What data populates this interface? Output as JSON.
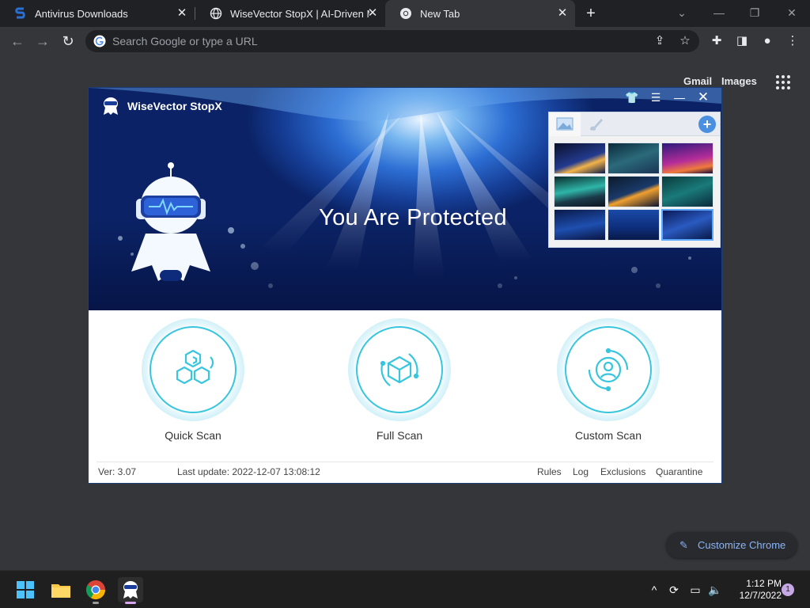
{
  "browser": {
    "tabs": [
      {
        "label": "Antivirus Downloads"
      },
      {
        "label": "WiseVector StopX | AI-Driven Ma"
      },
      {
        "label": "New Tab"
      }
    ],
    "new_tab_glyph": "+",
    "window_controls": {
      "dropdown": "⌄",
      "minimize": "—",
      "restore": "❐",
      "close": "✕"
    },
    "omnibox": {
      "placeholder": "Search Google or type a URL"
    },
    "ntp_links": {
      "gmail": "Gmail",
      "images": "Images"
    },
    "customize_label": "Customize Chrome"
  },
  "app": {
    "title": "WiseVector StopX",
    "status": "You Are Protected",
    "scans": [
      {
        "label": "Quick Scan",
        "icon": "hexagon-cluster-icon"
      },
      {
        "label": "Full Scan",
        "icon": "cube-icon"
      },
      {
        "label": "Custom Scan",
        "icon": "user-target-icon"
      }
    ],
    "footer": {
      "version": "Ver: 3.07",
      "last_update": "Last update: 2022-12-07 13:08:12",
      "links": [
        "Rules",
        "Log",
        "Exclusions",
        "Quarantine"
      ]
    },
    "skin_panel": {
      "add_glyph": "+",
      "thumbnails": [
        "linear-gradient(160deg,#0b0f2a 0%,#233b8f 55%,#f3b34a 70%,#0a1a4a 100%)",
        "linear-gradient(160deg,#0a2a3a 0%,#2b6a7a 50%,#1a3455 100%)",
        "linear-gradient(170deg,#2b1a7a 0%,#b42c9a 55%,#f07b3a 80%,#1a0a3a 100%)",
        "linear-gradient(170deg,#0a2a2a 0%,#2fb5a8 45%,#1a3a4a 70%,#0d1420 100%)",
        "linear-gradient(160deg,#0b1a2a 0%,#1a3a6a 50%,#f0a030 60%,#0b1430 100%)",
        "linear-gradient(160deg,#0a3a3a 0%,#1a7a7a 50%,#0a2a3a 100%)",
        "linear-gradient(170deg,#0a1a4a 0%,#1e4fb0 55%,#0a1440 100%)",
        "linear-gradient(180deg,#1a4aa8 0%,#0e2e7a 60%,#081a4a 100%)",
        "linear-gradient(160deg,#0a1a5a 0%,#2a5ac0 50%,#081a4a 100%)"
      ]
    }
  },
  "taskbar": {
    "tray_chevron": "^",
    "clock_time": "1:12 PM",
    "clock_date": "12/7/2022",
    "notifications": "1"
  },
  "colors": {
    "chrome_bg": "#35363a",
    "tabstrip_bg": "#202124",
    "accent_link": "#8ab4f8",
    "scan_ring": "#37c6dd",
    "hero_blue": "#163f98"
  }
}
